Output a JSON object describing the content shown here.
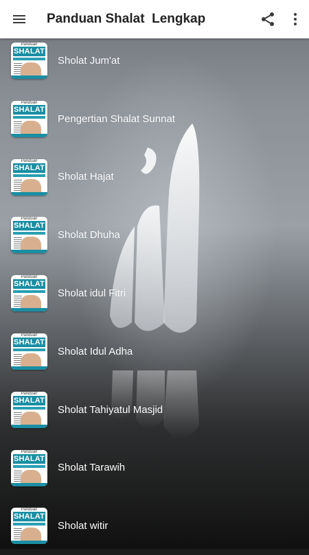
{
  "appbar": {
    "title": "Panduan Shalat  Lengkap",
    "menu_icon": "hamburger-menu-icon",
    "share_icon": "share-icon",
    "more_icon": "more-vert-icon"
  },
  "thumbnail": {
    "small_text": "Panduan",
    "brand_text": "SHALAT"
  },
  "list": [
    {
      "label": "Sholat Jum'at"
    },
    {
      "label": "Pengertian Shalat Sunnat"
    },
    {
      "label": "Sholat Hajat"
    },
    {
      "label": "Sholat Dhuha"
    },
    {
      "label": "Sholat idul Fitri"
    },
    {
      "label": "Sholat Idul Adha"
    },
    {
      "label": "Sholat Tahiyatul Masjid"
    },
    {
      "label": "Sholat Tarawih"
    },
    {
      "label": "Sholat witir"
    }
  ],
  "colors": {
    "appbar_bg": "#ffffff",
    "title": "#222222",
    "item_text": "#ffffff",
    "thumb_accent": "#1a8ea3"
  }
}
